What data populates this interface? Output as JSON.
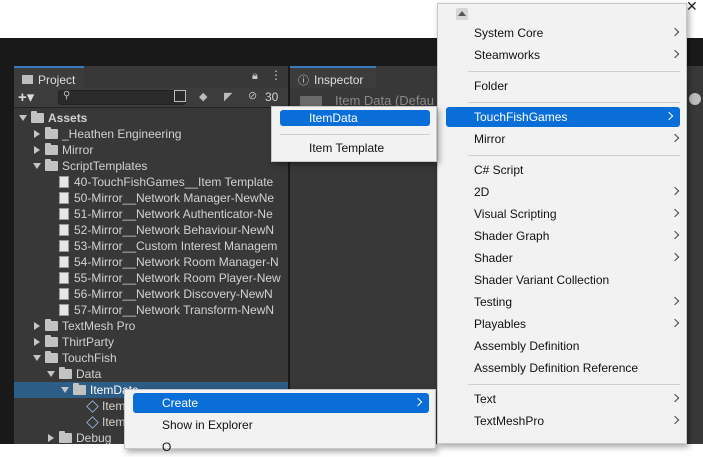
{
  "project": {
    "tab_label": "Project",
    "hidden_count": "30",
    "tree": [
      {
        "label": "Assets",
        "depth": 0,
        "arrow": "down",
        "icon": "folder",
        "bold": true
      },
      {
        "label": "_Heathen Engineering",
        "depth": 1,
        "arrow": "right",
        "icon": "folder"
      },
      {
        "label": "Mirror",
        "depth": 1,
        "arrow": "right",
        "icon": "folder"
      },
      {
        "label": "ScriptTemplates",
        "depth": 1,
        "arrow": "down",
        "icon": "folder"
      },
      {
        "label": "40-TouchFishGames__Item Template",
        "depth": 2,
        "icon": "file"
      },
      {
        "label": "50-Mirror__Network Manager-NewNe",
        "depth": 2,
        "icon": "file"
      },
      {
        "label": "51-Mirror__Network Authenticator-Ne",
        "depth": 2,
        "icon": "file"
      },
      {
        "label": "52-Mirror__Network Behaviour-NewN",
        "depth": 2,
        "icon": "file"
      },
      {
        "label": "53-Mirror__Custom Interest Managem",
        "depth": 2,
        "icon": "file"
      },
      {
        "label": "54-Mirror__Network Room Manager-N",
        "depth": 2,
        "icon": "file"
      },
      {
        "label": "55-Mirror__Network Room Player-New",
        "depth": 2,
        "icon": "file"
      },
      {
        "label": "56-Mirror__Network Discovery-NewN",
        "depth": 2,
        "icon": "file"
      },
      {
        "label": "57-Mirror__Network Transform-NewN",
        "depth": 2,
        "icon": "file"
      },
      {
        "label": "TextMesh Pro",
        "depth": 1,
        "arrow": "right",
        "icon": "folder"
      },
      {
        "label": "ThirtParty",
        "depth": 1,
        "arrow": "right",
        "icon": "folder"
      },
      {
        "label": "TouchFish",
        "depth": 1,
        "arrow": "down",
        "icon": "folder"
      },
      {
        "label": "Data",
        "depth": 2,
        "arrow": "down",
        "icon": "folder"
      },
      {
        "label": "ItemData",
        "depth": 3,
        "arrow": "down",
        "icon": "folder",
        "selected": true
      },
      {
        "label": "Item",
        "depth": 4,
        "icon": "cube"
      },
      {
        "label": "Item",
        "depth": 4,
        "icon": "cube"
      },
      {
        "label": "Debug",
        "depth": 2,
        "arrow": "right",
        "icon": "folder"
      }
    ]
  },
  "inspector": {
    "tab_label": "Inspector",
    "title": "Item Data (Defau"
  },
  "asset_menu": {
    "items": [
      {
        "label": "Create",
        "submenu": true,
        "highlighted": true
      },
      {
        "label": "Show in Explorer"
      },
      {
        "label": "O"
      }
    ]
  },
  "create_menu": {
    "items": [
      {
        "label": "System Core",
        "submenu": true
      },
      {
        "label": "Steamworks",
        "submenu": true
      },
      {
        "separator": true
      },
      {
        "label": "Folder"
      },
      {
        "separator": true
      },
      {
        "label": "TouchFishGames",
        "submenu": true,
        "highlighted": true
      },
      {
        "label": "Mirror",
        "submenu": true
      },
      {
        "separator": true
      },
      {
        "label": "C# Script"
      },
      {
        "label": "2D",
        "submenu": true
      },
      {
        "label": "Visual Scripting",
        "submenu": true
      },
      {
        "label": "Shader Graph",
        "submenu": true
      },
      {
        "label": "Shader",
        "submenu": true
      },
      {
        "label": "Shader Variant Collection"
      },
      {
        "label": "Testing",
        "submenu": true
      },
      {
        "label": "Playables",
        "submenu": true
      },
      {
        "label": "Assembly Definition"
      },
      {
        "label": "Assembly Definition Reference"
      },
      {
        "separator": true
      },
      {
        "label": "Text",
        "submenu": true
      },
      {
        "label": "TextMeshPro",
        "submenu": true
      }
    ]
  },
  "touchfish_menu": {
    "items": [
      {
        "label": "ItemData",
        "highlighted": true
      },
      {
        "separator": true
      },
      {
        "label": "Item Template"
      }
    ]
  },
  "colors": {
    "menu_highlight": "#0a6ed8",
    "editor_dark": "#191919",
    "panel": "#383838",
    "selection": "#2c5d87"
  }
}
